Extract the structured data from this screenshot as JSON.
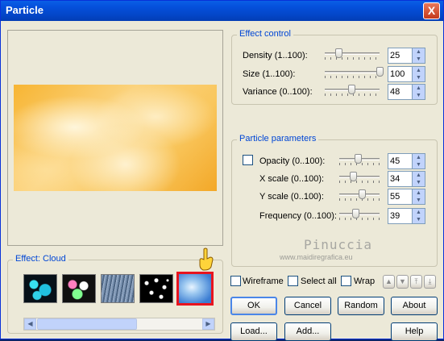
{
  "window": {
    "title": "Particle",
    "close_glyph": "X"
  },
  "effect_control": {
    "legend": "Effect control",
    "rows": [
      {
        "label": "Density (1..100):",
        "value": "25",
        "level": 0.25
      },
      {
        "label": "Size (1..100):",
        "value": "100",
        "level": 1.0
      },
      {
        "label": "Variance (0..100):",
        "value": "48",
        "level": 0.48
      }
    ]
  },
  "particle_params": {
    "legend": "Particle parameters",
    "rows": [
      {
        "label": "Opacity (0..100):",
        "value": "45",
        "level": 0.45
      },
      {
        "label": "X scale (0..100):",
        "value": "34",
        "level": 0.34
      },
      {
        "label": "Y scale (0..100):",
        "value": "55",
        "level": 0.55
      },
      {
        "label": "Frequency (0..100):",
        "value": "39",
        "level": 0.39
      }
    ]
  },
  "effect_panel": {
    "legend": "Effect: Cloud"
  },
  "watermark": {
    "line1": "Pinuccia",
    "line2": "www.maidiregrafica.eu"
  },
  "options": {
    "wireframe": "Wireframe",
    "select_all": "Select all",
    "wrap": "Wrap"
  },
  "buttons": {
    "ok": "OK",
    "cancel": "Cancel",
    "random": "Random",
    "about": "About",
    "load": "Load...",
    "add": "Add...",
    "help": "Help"
  },
  "colors": {
    "accent": "#0046d5",
    "selected_border": "#e8141e"
  }
}
